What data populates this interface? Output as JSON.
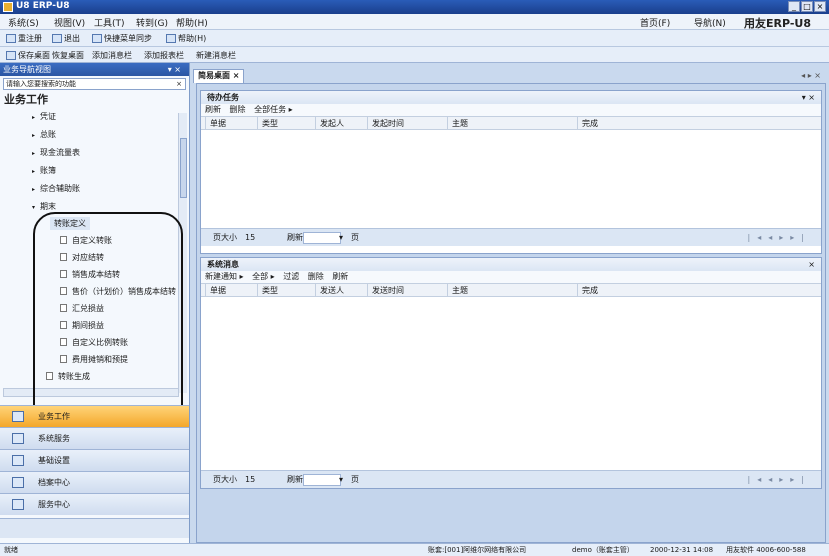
{
  "window": {
    "title": "U8 ERP-U8"
  },
  "menu": {
    "items": [
      "系统(S)",
      "视图(V)",
      "工具(T)",
      "转到(G)",
      "帮助(H)"
    ],
    "right_items": [
      "首页(F)",
      "导航(N)"
    ],
    "brand": "用友ERP-U8"
  },
  "toolbar": {
    "row1": [
      "重注册",
      "退出",
      "快捷菜单同步",
      "帮助(H)"
    ],
    "row2": [
      "保存桌面",
      "恢复桌面",
      "添加消息栏",
      "添加报表栏",
      "新建消息栏"
    ]
  },
  "sidebar": {
    "header": "业务导航视图",
    "search_placeholder": "请输入您要搜索的功能",
    "section_title": "业务工作",
    "tree": [
      "凭证",
      "总账",
      "现金流量表",
      "账簿",
      "综合辅助账",
      "期末"
    ],
    "subgroup": "转账定义",
    "subitems": [
      "自定义转账",
      "对应结转",
      "销售成本结转",
      "售价（计划价）销售成本结转",
      "汇兑损益",
      "期间损益",
      "自定义比例转账",
      "费用摊销和预提"
    ],
    "after": "转账生成",
    "nav": [
      "业务工作",
      "系统服务",
      "基础设置",
      "档案中心",
      "服务中心"
    ]
  },
  "tabs": [
    {
      "label": "简易桌面"
    }
  ],
  "tasks_panel": {
    "title": "待办任务",
    "tools": [
      "刷新",
      "删除",
      "全部任务 ▸"
    ],
    "columns": [
      "单据",
      "类型",
      "发起人",
      "发起时间",
      "主题",
      "完成"
    ],
    "page_size_label": "页大小",
    "page_size": "15",
    "refresh": "刷新",
    "page_label": "页"
  },
  "messages_panel": {
    "title": "系统消息",
    "tools": [
      "新建通知 ▸",
      "全部 ▸",
      "过滤",
      "删除",
      "刷新"
    ],
    "columns": [
      "单据",
      "类型",
      "发送人",
      "发送时间",
      "主题",
      "完成"
    ],
    "page_size_label": "页大小",
    "page_size": "15",
    "refresh": "刷新",
    "page_label": "页"
  },
  "status": {
    "left": "就绪",
    "account": "账套:[001]阿维尔网络有限公司",
    "user": "demo（账套主管）",
    "date": "2000-12-31 14:08",
    "support": "用友软件 4006-600-588"
  }
}
